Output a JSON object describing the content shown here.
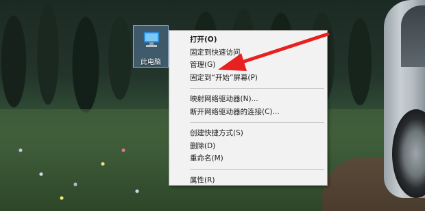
{
  "desktop": {
    "icon_label": "此电脑",
    "icon_name": "computer-icon"
  },
  "context_menu": {
    "items": [
      {
        "label": "打开(O)",
        "bold": true
      },
      {
        "label": "固定到快速访问"
      },
      {
        "label": "管理(G)"
      },
      {
        "label": "固定到“开始”屏幕(P)"
      },
      {
        "label": "映射网络驱动器(N)..."
      },
      {
        "label": "断开网络驱动器的连接(C)..."
      },
      {
        "label": "创建快捷方式(S)"
      },
      {
        "label": "删除(D)"
      },
      {
        "label": "重命名(M)"
      },
      {
        "label": "属性(R)"
      }
    ]
  },
  "annotation": {
    "arrow_color": "#e8201f",
    "points_to": "管理(G)"
  }
}
